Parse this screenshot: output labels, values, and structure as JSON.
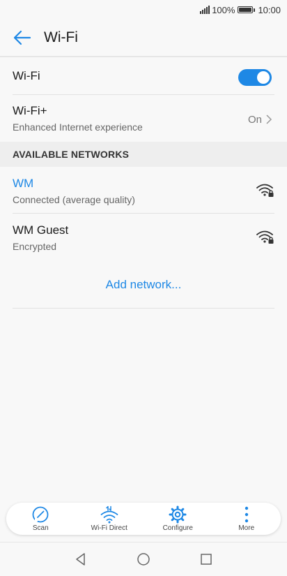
{
  "status_bar": {
    "battery_text": "100%",
    "time": "10:00"
  },
  "header": {
    "title": "Wi-Fi",
    "back_icon": "back-arrow-icon"
  },
  "wifi_toggle": {
    "label": "Wi-Fi",
    "state": "on",
    "accent_color": "#1e88e5"
  },
  "wifi_plus": {
    "label": "Wi-Fi+",
    "subtitle": "Enhanced Internet experience",
    "value": "On"
  },
  "available_networks": {
    "header": "AVAILABLE NETWORKS",
    "networks": [
      {
        "name": "WM",
        "status": "Connected (average quality)",
        "connected": true,
        "icon": "wifi-lock-icon"
      },
      {
        "name": "WM Guest",
        "status": "Encrypted",
        "connected": false,
        "icon": "wifi-lock-icon"
      }
    ],
    "add_label": "Add network..."
  },
  "toolbar": {
    "items": [
      {
        "label": "Scan",
        "icon": "scan-icon"
      },
      {
        "label": "Wi-Fi Direct",
        "icon": "wifi-direct-icon"
      },
      {
        "label": "Configure",
        "icon": "gear-icon"
      },
      {
        "label": "More",
        "icon": "more-vert-icon"
      }
    ],
    "icon_color": "#1e88e5"
  },
  "nav_bar": {
    "buttons": [
      "back-triangle-icon",
      "home-circle-icon",
      "recents-square-icon"
    ]
  }
}
